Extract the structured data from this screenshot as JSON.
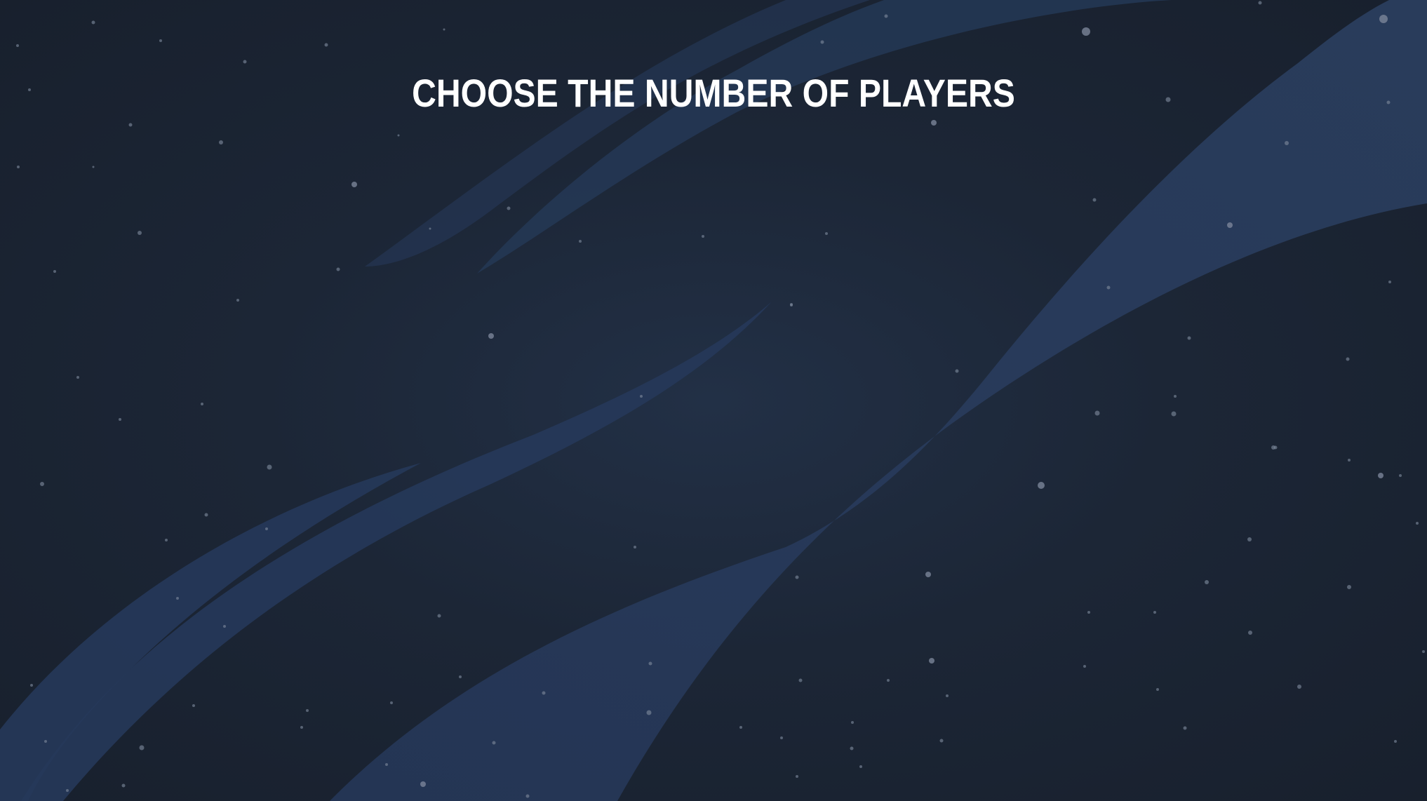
{
  "screen": {
    "title": "CHOOSE THE NUMBER OF PLAYERS"
  },
  "theme": {
    "background": "#1a2230",
    "ribbon": "#2a3d5c",
    "star": "#7a8598",
    "text": "#ffffff"
  }
}
